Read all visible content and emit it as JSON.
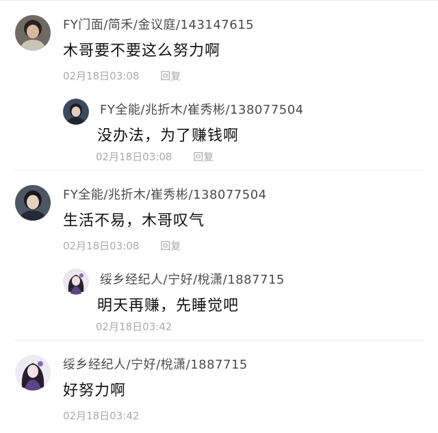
{
  "comments": [
    {
      "user": "FY门面/简禾/金议庭/143147615",
      "text": "木哥要不要这么努力啊",
      "time": "02月18日03:08",
      "reply_label": "回复",
      "avatar_icon": "avatar-dark-hair-icon"
    },
    {
      "user": "FY全能/兆折木/崔秀彬/138077504",
      "text": "没办法，为了赚钱啊",
      "time": "02月18日03:08",
      "reply_label": "回复",
      "avatar_icon": "avatar-dark-hair-icon"
    },
    {
      "user": "FY全能/兆折木/崔秀彬/138077504",
      "text": "生活不易，木哥叹气",
      "time": "02月18日03:08",
      "reply_label": "回复",
      "avatar_icon": "avatar-dark-hair-icon"
    },
    {
      "user": "绥乡经纪人/宁好/梲潇/1887715",
      "text": "明天再赚，先睡觉吧",
      "time": "02月18日03:42",
      "avatar_icon": "avatar-anime-girl-icon"
    },
    {
      "user": "绥乡经纪人/宁好/梲潇/1887715",
      "text": "好努力啊",
      "time": "02月18日03:42",
      "avatar_icon": "avatar-anime-girl-icon"
    }
  ]
}
